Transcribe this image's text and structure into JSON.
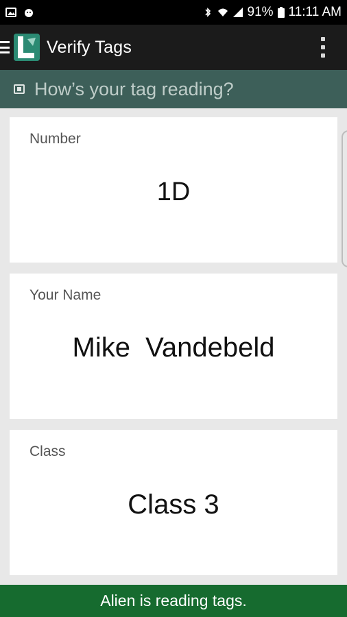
{
  "status_bar": {
    "battery": "91%",
    "time": "11:11 AM"
  },
  "app_bar": {
    "title": "Verify Tags"
  },
  "subheader": {
    "text": "How’s your tag reading?"
  },
  "cards": [
    {
      "label": "Number",
      "value": "1D"
    },
    {
      "label": "Your Name",
      "value": "Mike  Vandebeld"
    },
    {
      "label": "Class",
      "value": "Class 3"
    }
  ],
  "status_message": "Alien is reading tags.",
  "colors": {
    "app_bar_bg": "#1b1b1b",
    "subheader_bg": "#3d5f59",
    "status_message_bg": "#166b2f",
    "logo_accent": "#2b8a73"
  }
}
